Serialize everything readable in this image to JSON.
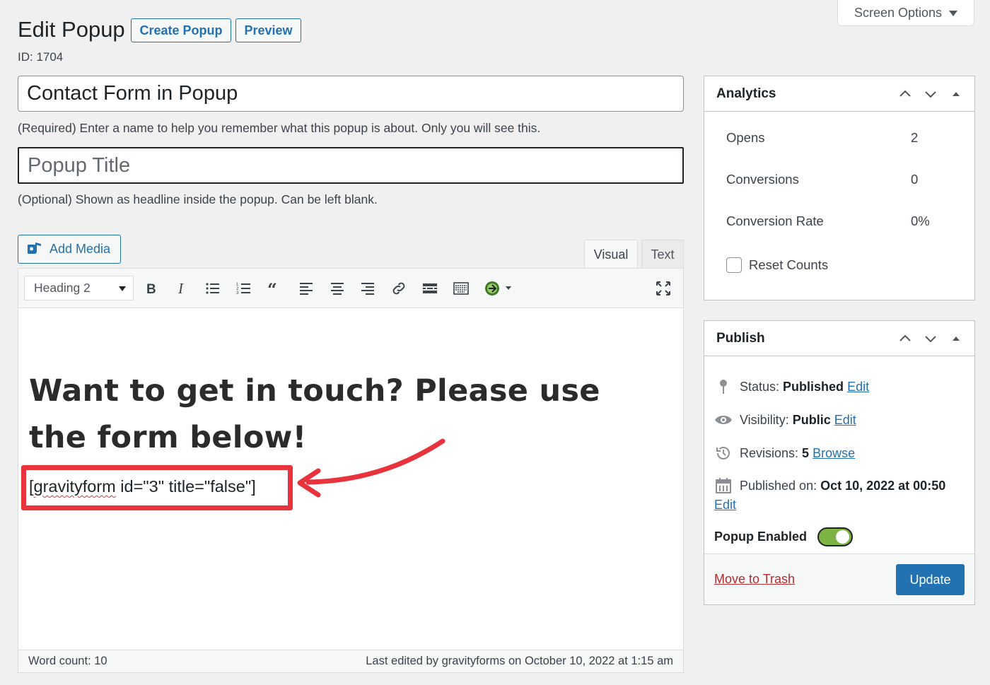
{
  "screen_options": {
    "label": "Screen Options"
  },
  "header": {
    "title": "Edit Popup",
    "create_label": "Create Popup",
    "preview_label": "Preview",
    "id_text": "ID: 1704"
  },
  "form": {
    "name_value": "Contact Form in Popup",
    "name_help": "(Required) Enter a name to help you remember what this popup is about. Only you will see this.",
    "title_placeholder": "Popup Title",
    "title_help": "(Optional) Shown as headline inside the popup. Can be left blank."
  },
  "editor": {
    "add_media_label": "Add Media",
    "tabs": [
      "Visual",
      "Text"
    ],
    "format_value": "Heading 2",
    "heading": "Want to get in touch? Please use the form below!",
    "shortcode_prefix": "[",
    "shortcode_word": "gravityform",
    "shortcode_rest": " id=\"3\" title=\"false\"]",
    "word_count": "Word count: 10",
    "last_edited": "Last edited by gravityforms on October 10, 2022 at 1:15 am",
    "toolbar_icons": [
      "bold-icon",
      "italic-icon",
      "bullet-list-icon",
      "numbered-list-icon",
      "blockquote-icon",
      "align-left-icon",
      "align-center-icon",
      "align-right-icon",
      "link-icon",
      "read-more-icon",
      "toolbar-toggle-icon",
      "gravity-forms-icon",
      "fullscreen-icon"
    ]
  },
  "analytics": {
    "title": "Analytics",
    "rows": [
      {
        "label": "Opens",
        "value": "2"
      },
      {
        "label": "Conversions",
        "value": "0"
      },
      {
        "label": "Conversion Rate",
        "value": "0%"
      }
    ],
    "reset_label": "Reset Counts"
  },
  "publish": {
    "title": "Publish",
    "status_label": "Status: ",
    "status_value": "Published",
    "visibility_label": "Visibility: ",
    "visibility_value": "Public",
    "revisions_label": "Revisions: ",
    "revisions_value": "5",
    "published_label": "Published on: ",
    "published_value": "Oct 10, 2022 at 00:50",
    "edit_label": "Edit",
    "browse_label": "Browse",
    "popup_enabled_label": "Popup Enabled",
    "trash_label": "Move to Trash",
    "update_label": "Update",
    "accent": "#2271b1",
    "toggle_color": "#7cb342"
  },
  "annotation": {
    "highlight_color": "#e8323c"
  }
}
